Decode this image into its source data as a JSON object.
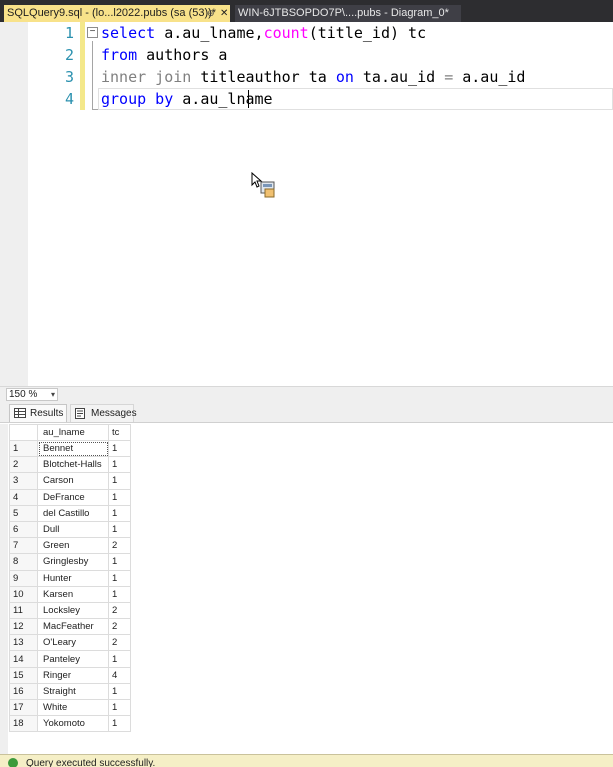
{
  "tabs": {
    "active": {
      "title": "SQLQuery9.sql - (lo...l2022.pubs (sa (53))*",
      "pin": "⊕",
      "close": "✕"
    },
    "inactive": {
      "title": "WIN-6JTBSOPDO7P\\....pubs - Diagram_0*"
    }
  },
  "editor": {
    "lines": [
      {
        "num": "1",
        "tokens": [
          [
            "kw",
            "select"
          ],
          [
            "",
            " a.au_lname,"
          ],
          [
            "fn",
            "count"
          ],
          [
            "",
            "(title_id) tc"
          ]
        ]
      },
      {
        "num": "2",
        "tokens": [
          [
            "kw",
            "from"
          ],
          [
            "",
            " authors a"
          ]
        ]
      },
      {
        "num": "3",
        "tokens": [
          [
            "gr",
            "inner join"
          ],
          [
            "",
            " titleauthor ta "
          ],
          [
            "kw",
            "on"
          ],
          [
            "",
            " ta.au_id "
          ],
          [
            "gr",
            "="
          ],
          [
            "",
            " a.au_id"
          ]
        ]
      },
      {
        "num": "4",
        "tokens": [
          [
            "kw",
            "group by"
          ],
          [
            "",
            " a.au_lname"
          ]
        ]
      }
    ],
    "collapse_glyph": "−"
  },
  "zoom": {
    "value": "150 %",
    "arrow": "▾"
  },
  "results_tabs": {
    "results": "Results",
    "messages": "Messages"
  },
  "grid": {
    "columns": [
      "au_lname",
      "tc"
    ],
    "rows": [
      [
        "1",
        "Bennet",
        "1"
      ],
      [
        "2",
        "Blotchet-Halls",
        "1"
      ],
      [
        "3",
        "Carson",
        "1"
      ],
      [
        "4",
        "DeFrance",
        "1"
      ],
      [
        "5",
        "del Castillo",
        "1"
      ],
      [
        "6",
        "Dull",
        "1"
      ],
      [
        "7",
        "Green",
        "2"
      ],
      [
        "8",
        "Gringlesby",
        "1"
      ],
      [
        "9",
        "Hunter",
        "1"
      ],
      [
        "10",
        "Karsen",
        "1"
      ],
      [
        "11",
        "Locksley",
        "2"
      ],
      [
        "12",
        "MacFeather",
        "2"
      ],
      [
        "13",
        "O'Leary",
        "2"
      ],
      [
        "14",
        "Panteley",
        "1"
      ],
      [
        "15",
        "Ringer",
        "4"
      ],
      [
        "16",
        "Straight",
        "1"
      ],
      [
        "17",
        "White",
        "1"
      ],
      [
        "18",
        "Yokomoto",
        "1"
      ]
    ]
  },
  "status": {
    "text": "Query executed successfully."
  },
  "colors": {
    "tab_active": "#f8e28a",
    "keyword": "#0000ff",
    "function": "#ff00ff",
    "operator": "#808080",
    "line_number": "#2b91af",
    "status_bar": "#f5efc6"
  }
}
